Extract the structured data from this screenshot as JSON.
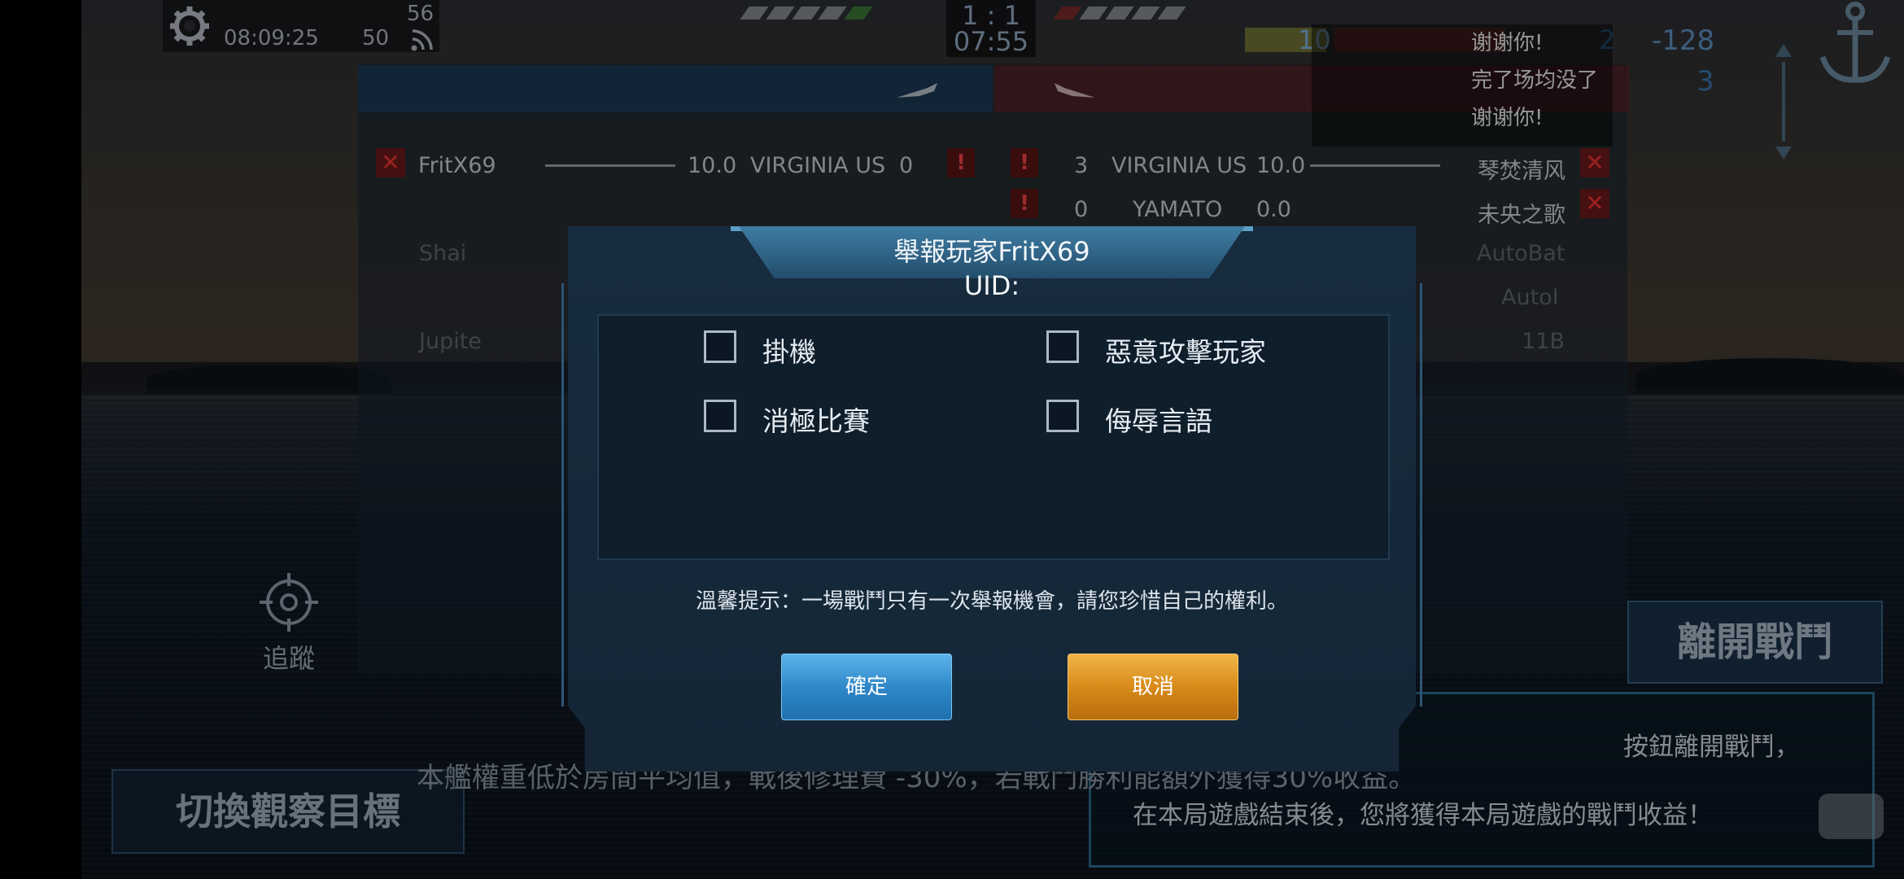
{
  "hud": {
    "clock": "08:09:25",
    "ping": "50",
    "signal_value": "56",
    "score_left": "1",
    "score_sep": ":",
    "score_right": "1",
    "match_timer": "07:55",
    "ally_tag": "10",
    "enemy_count_1": "2",
    "enemy_value": "-128",
    "enemy_count_2": "3"
  },
  "scoreboard": {
    "ally_rows": [
      {
        "name": "FritX69",
        "tier": "10.0",
        "ship": "VIRGINIA US",
        "kills": "0"
      }
    ],
    "ally_faded_names": [
      "Shai",
      "Jupite"
    ],
    "enemy_rows": [
      {
        "name": "琴焚清风",
        "tier": "10.0",
        "ship": "VIRGINIA US",
        "kills": "3"
      },
      {
        "name": "未央之歌",
        "tier": "0.0",
        "ship": "YAMATO",
        "kills": "0"
      }
    ],
    "enemy_faded_names": [
      "AutoBat",
      "AutoI",
      "11B"
    ]
  },
  "chat": {
    "messages": [
      {
        "name": "",
        "text": "谢谢你!"
      },
      {
        "name": "",
        "text": "完了场均没了"
      },
      {
        "name": "",
        "text": "谢谢你!"
      }
    ]
  },
  "controls": {
    "track_label": "追蹤",
    "switch_target": "切換觀察目標",
    "leave_battle": "離開戰鬥",
    "bottom_notice": "本艦權重低於房間平均值，戰後修理費 -30%，若戰鬥勝利能額外獲得30%收益。",
    "info_line_1": "按鈕離開戰鬥，",
    "info_line_2": "在本局遊戲結束後，您將獲得本局遊戲的戰鬥收益！"
  },
  "dialog": {
    "title": "舉報玩家FritX69",
    "uid_label": "UID:",
    "options": [
      {
        "label": "掛機",
        "checked": false
      },
      {
        "label": "惡意攻擊玩家",
        "checked": false
      },
      {
        "label": "消極比賽",
        "checked": false
      },
      {
        "label": "侮辱言語",
        "checked": false
      }
    ],
    "tip": "溫馨提示：一場戰鬥只有一次舉報機會，請您珍惜自己的權利。",
    "confirm_label": "確定",
    "cancel_label": "取消"
  },
  "colors": {
    "confirm_button": "#2f88c8",
    "cancel_button": "#d88a19",
    "enemy_red": "#c2201f",
    "dialog_bg": "#142636"
  },
  "icons": [
    "gear-icon",
    "signal-icon",
    "crosshair-icon",
    "anchor-icon",
    "chat-icon",
    "plane-icon",
    "close-icon",
    "warning-icon"
  ]
}
